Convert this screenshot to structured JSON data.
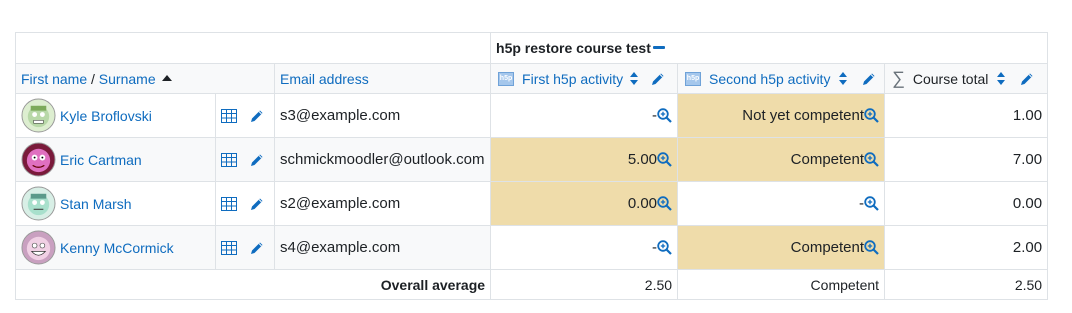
{
  "category": {
    "name": "h5p restore course test"
  },
  "header": {
    "first_name": "First name",
    "separator": " / ",
    "surname": "Surname",
    "email": "Email address",
    "items": [
      {
        "label": "First h5p activity"
      },
      {
        "label": "Second h5p activity"
      },
      {
        "label": "Course total"
      }
    ]
  },
  "users": [
    {
      "name": "Kyle Broflovski",
      "email": "s3@example.com",
      "grade1": "-",
      "grade2": "Not yet competent",
      "total": "1.00",
      "avatar_color": "#b8d8a8"
    },
    {
      "name": "Eric Cartman",
      "email": "schmickmoodler@outlook.com",
      "grade1": "5.00",
      "grade2": "Competent",
      "total": "7.00",
      "avatar_color": "#e070c0"
    },
    {
      "name": "Stan Marsh",
      "email": "s2@example.com",
      "grade1": "0.00",
      "grade2": "-",
      "total": "0.00",
      "avatar_color": "#a8e0cc"
    },
    {
      "name": "Kenny McCormick",
      "email": "s4@example.com",
      "grade1": "-",
      "grade2": "Competent",
      "total": "2.00",
      "avatar_color": "#e0b8d8"
    }
  ],
  "average": {
    "label": "Overall average",
    "item1": "2.50",
    "item2": "Competent",
    "total": "2.50"
  },
  "colors": {
    "link": "#0f6cbf",
    "highlight": "#efdcaa",
    "header_bg": "#f8f9fa"
  }
}
